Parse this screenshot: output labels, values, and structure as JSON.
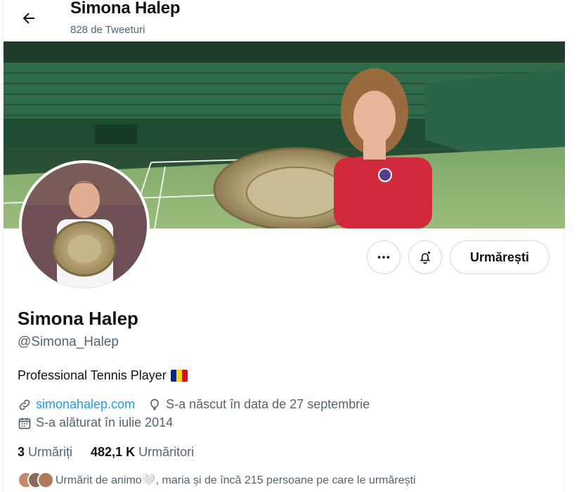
{
  "header": {
    "name": "Simona Halep",
    "tweet_count": "828 de Tweeturi"
  },
  "profile": {
    "display_name": "Simona Halep",
    "handle": "@Simona_Halep",
    "bio": "Professional Tennis Player",
    "website": "simonahalep.com",
    "birth": "S-a născut în data de 27 septembrie",
    "joined": "S-a alăturat în iulie 2014",
    "following_count": "3",
    "following_label": "Urmăriți",
    "followers_count": "482,1 K",
    "followers_label": "Urmăritori",
    "followed_by": "Urmărit de animo🤍, maria și de încă 215 persoane pe care le urmărești"
  },
  "actions": {
    "follow_label": "Urmărești"
  },
  "colors": {
    "link": "#1d9bf0",
    "muted": "#536471",
    "text": "#0f1419",
    "border": "#cfd9de",
    "flag_blue": "#002b7f",
    "flag_yellow": "#fcd116",
    "flag_red": "#ce1126"
  },
  "icons": {
    "back": "arrow-left-icon",
    "more": "more-horizontal-icon",
    "notify": "bell-plus-icon",
    "link": "link-icon",
    "location": "balloon-icon",
    "calendar": "calendar-icon"
  }
}
